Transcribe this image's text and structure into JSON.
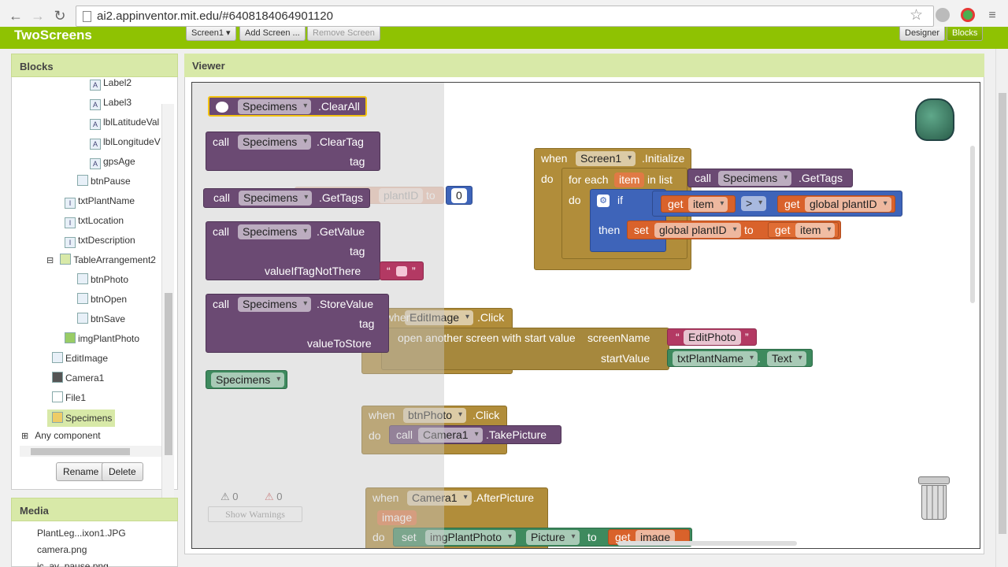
{
  "browser": {
    "url": "ai2.appinventor.mit.edu/#6408184064901120"
  },
  "app": {
    "project_title": "TwoScreens",
    "screen_button": "Screen1 ▾",
    "add_screen": "Add Screen ...",
    "remove_screen": "Remove Screen",
    "designer": "Designer",
    "blocks": "Blocks"
  },
  "blocks_panel": {
    "title": "Blocks",
    "items": [
      "Label2",
      "Label3",
      "lblLatitudeVal",
      "lblLongitudeV",
      "gpsAge",
      "btnPause",
      "txtPlantName",
      "txtLocation",
      "txtDescription",
      "TableArrangement2",
      "btnPhoto",
      "btnOpen",
      "btnSave",
      "imgPlantPhoto",
      "EditImage",
      "Camera1",
      "File1",
      "Specimens",
      "Any component"
    ],
    "rename": "Rename",
    "delete": "Delete"
  },
  "media_panel": {
    "title": "Media",
    "items": [
      "PlantLeg...ixon1.JPG",
      "camera.png",
      "ic_av_pause.png"
    ]
  },
  "viewer": {
    "title": "Viewer",
    "flyout": {
      "clearall": {
        "component": "Specimens",
        "method": ".ClearAll"
      },
      "cleartag": {
        "call": "call",
        "component": "Specimens",
        "method": ".ClearTag",
        "arg": "tag"
      },
      "gettags": {
        "call": "call",
        "component": "Specimens",
        "method": ".GetTags"
      },
      "getvalue": {
        "call": "call",
        "component": "Specimens",
        "method": ".GetValue",
        "arg1": "tag",
        "arg2": "valueIfTagNotThere",
        "quote": "“",
        "quote_close": "”"
      },
      "storevalue": {
        "call": "call",
        "component": "Specimens",
        "method": ".StoreValue",
        "arg1": "tag",
        "arg2": "valueToStore"
      },
      "component_block": "Specimens"
    },
    "init_block": {
      "when": "when",
      "component": "Screen1",
      "event": ".Initialize",
      "do": "do",
      "for_each": "for each",
      "item": "item",
      "in_list": "in list",
      "call": "call",
      "call_component": "Specimens",
      "call_method": ".GetTags",
      "do2": "do",
      "if": "if",
      "get": "get",
      "get_item": "item",
      "op": ">",
      "get2": "get",
      "global_var": "global plantID",
      "then": "then",
      "set": "set",
      "set_var": "global plantID",
      "to": "to",
      "get3": "get",
      "get3_item": "item"
    },
    "editimage_block": {
      "when": "when",
      "component": "EditImage",
      "event": ".Click",
      "do": "do",
      "open": "open another screen with start value",
      "screen_name": "screenName",
      "screen_value": "EditPhoto",
      "start_value": "startValue",
      "text_component": "txtPlantName",
      "text_prop": "Text",
      "dot": "."
    },
    "btnphoto_block": {
      "when": "when",
      "component": "btnPhoto",
      "event": ".Click",
      "do": "do",
      "call": "call",
      "call_component": "Camera1",
      "call_method": ".TakePicture"
    },
    "afterpicture_block": {
      "when": "when",
      "component": "Camera1",
      "event": ".AfterPicture",
      "param": "image",
      "do": "do",
      "set": "set",
      "set_component": "imgPlantPhoto",
      "set_prop": "Picture",
      "to": "to",
      "get": "get",
      "get_var": "image"
    },
    "global_ghost": {
      "var": "plantID",
      "to": "to",
      "value": "0"
    },
    "warnings": {
      "warn_count": "0",
      "error_count": "0",
      "show_warnings": "Show Warnings"
    }
  }
}
